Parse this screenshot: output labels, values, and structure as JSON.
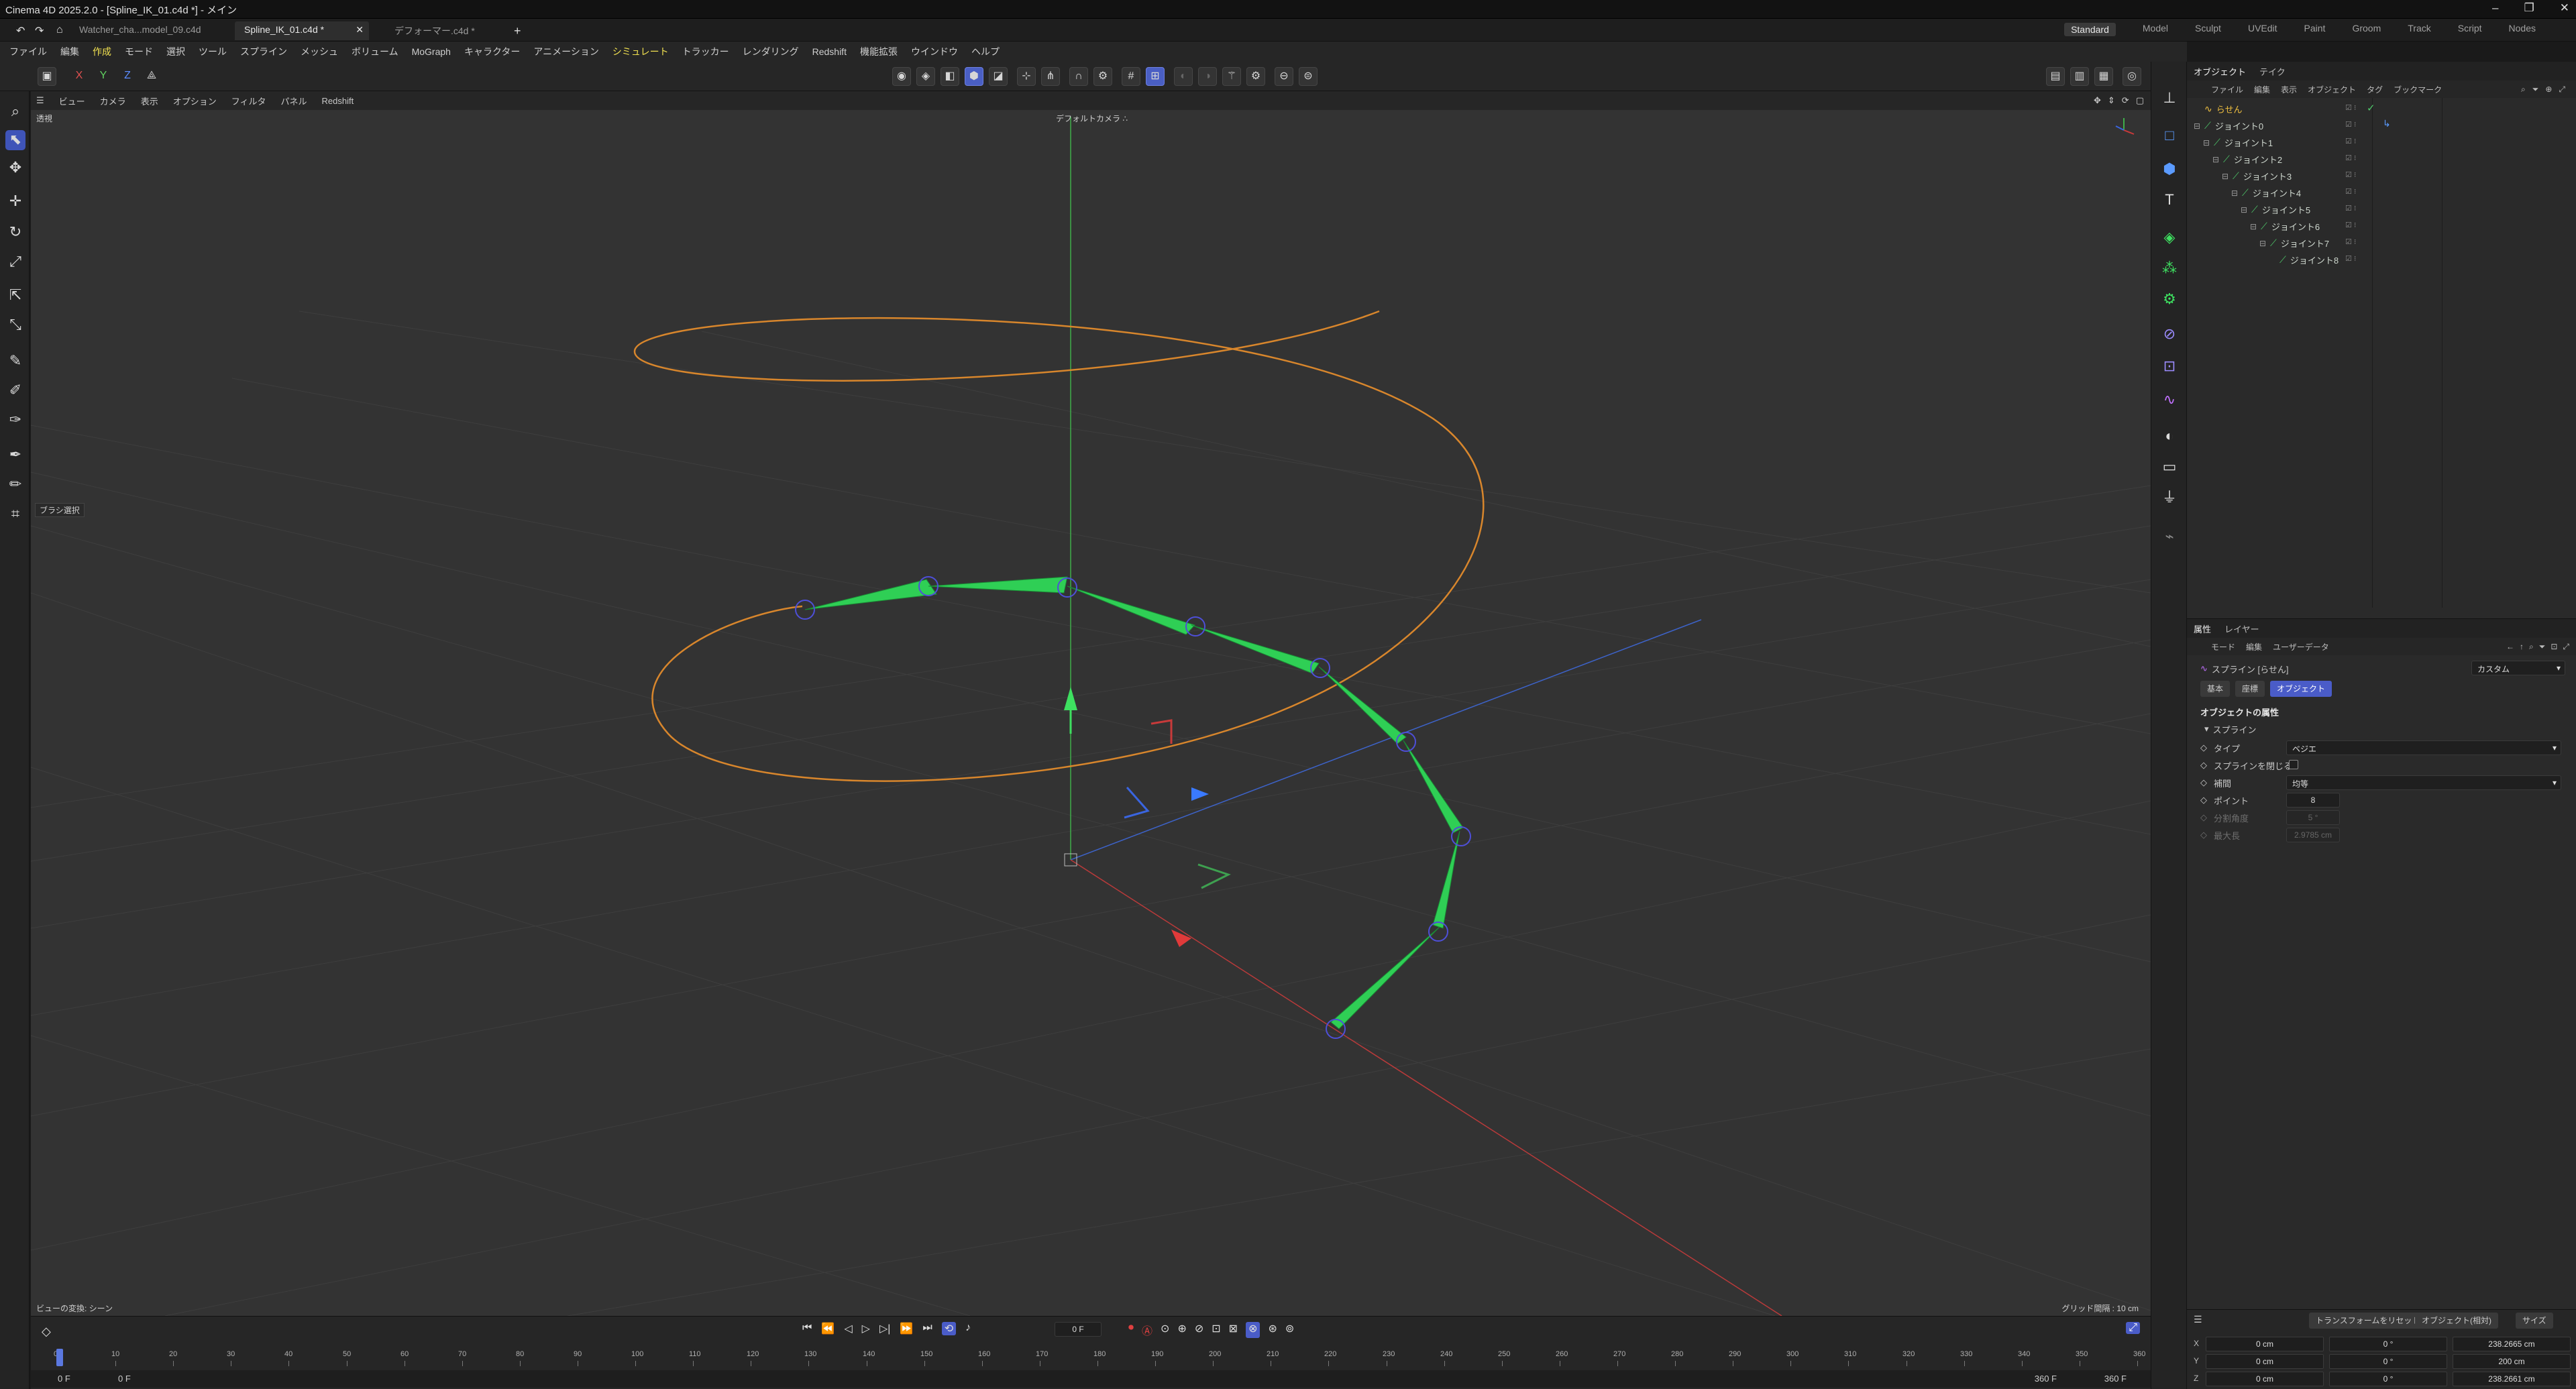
{
  "app": {
    "title": "Cinema 4D 2025.2.0 - [Spline_IK_01.c4d *] - メイン"
  },
  "window_controls": [
    "–",
    "❐",
    "✕"
  ],
  "doc_tabs": [
    {
      "label": "Watcher_cha...model_09.c4d"
    },
    {
      "label": "Spline_IK_01.c4d *"
    },
    {
      "label": "デフォーマー.c4d *"
    }
  ],
  "add_tab_label": "+",
  "layouts": [
    "Standard",
    "Model",
    "Sculpt",
    "UVEdit",
    "Paint",
    "Groom",
    "Track",
    "Script",
    "Nodes"
  ],
  "menu": [
    "ファイル",
    "編集",
    "作成",
    "モード",
    "選択",
    "ツール",
    "スプライン",
    "メッシュ",
    "ボリューム",
    "MoGraph",
    "キャラクター",
    "アニメーション",
    "シミュレート",
    "トラッカー",
    "レンダリング",
    "Redshift",
    "機能拡張",
    "ウインドウ",
    "ヘルプ"
  ],
  "axis_lock": {
    "x": "X",
    "y": "Y",
    "z": "Z"
  },
  "viewport": {
    "menu": [
      "ビュー",
      "カメラ",
      "表示",
      "オプション",
      "フィルタ",
      "パネル",
      "Redshift"
    ],
    "mode_label": "透視",
    "camera_label": "デフォルトカメラ ∴",
    "brush_tooltip": "ブラシ選択",
    "status_left": "ビューの変換: シーン",
    "grid_spacing": "グリッド間隔 : 10 cm",
    "spline_color": "#d8862c",
    "bone_color": "#2ecc4f"
  },
  "timeline": {
    "ticks": [
      "0",
      "10",
      "20",
      "30",
      "40",
      "50",
      "60",
      "70",
      "80",
      "90",
      "100",
      "110",
      "120",
      "130",
      "140",
      "150",
      "160",
      "170",
      "180",
      "190",
      "200",
      "210",
      "220",
      "230",
      "240",
      "250",
      "260",
      "270",
      "280",
      "290",
      "300",
      "310",
      "320",
      "330",
      "340",
      "350",
      "360"
    ],
    "current_frame": "0 F",
    "start_frame": "0 F",
    "start_frame_b": "0 F",
    "end_frame": "360 F",
    "end_frame_b": "360 F"
  },
  "objects_panel": {
    "tabs": [
      "オブジェクト",
      "テイク"
    ],
    "menu": [
      "ファイル",
      "編集",
      "表示",
      "オブジェクト",
      "タグ",
      "ブックマーク"
    ],
    "items": [
      {
        "label": "らせん",
        "depth": 0
      },
      {
        "label": "ジョイント0",
        "depth": 0
      },
      {
        "label": "ジョイント1",
        "depth": 1
      },
      {
        "label": "ジョイント2",
        "depth": 2
      },
      {
        "label": "ジョイント3",
        "depth": 3
      },
      {
        "label": "ジョイント4",
        "depth": 4
      },
      {
        "label": "ジョイント5",
        "depth": 5
      },
      {
        "label": "ジョイント6",
        "depth": 6
      },
      {
        "label": "ジョイント7",
        "depth": 7
      },
      {
        "label": "ジョイント8",
        "depth": 8
      }
    ]
  },
  "attributes_panel": {
    "tabs": [
      "属性",
      "レイヤー"
    ],
    "menu": [
      "モード",
      "編集",
      "ユーザーデータ"
    ],
    "object_name": "スプライン [らせん]",
    "custom_label": "カスタム",
    "subtabs": [
      "基本",
      "座標",
      "オブジェクト"
    ],
    "section_title": "オブジェクトの属性",
    "group_title": "スプライン",
    "fields": [
      {
        "label": "タイプ",
        "value": "ベジエ"
      },
      {
        "label": "スプラインを閉じる",
        "value": ""
      },
      {
        "label": "補間",
        "value": "均等"
      },
      {
        "label": "ポイント",
        "value": "8"
      },
      {
        "label": "分割角度",
        "value": "5 °"
      },
      {
        "label": "最大長",
        "value": "2.9785 cm"
      }
    ]
  },
  "coordinates": {
    "buttons": [
      "トランスフォームをリセット",
      "オブジェクト(相対)",
      "サイズ"
    ],
    "rows": [
      {
        "axis": "X",
        "pos": "0 cm",
        "rot": "0 °",
        "size": "238.2665 cm"
      },
      {
        "axis": "Y",
        "pos": "0 cm",
        "rot": "0 °",
        "size": "200 cm"
      },
      {
        "axis": "Z",
        "pos": "0 cm",
        "rot": "0 °",
        "size": "238.2661 cm"
      }
    ]
  }
}
